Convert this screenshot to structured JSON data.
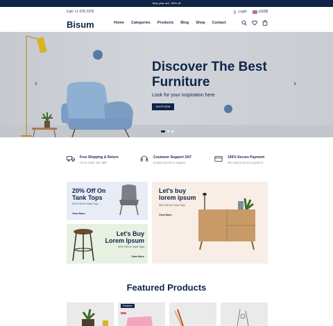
{
  "announcement": "New year sell : 30% off",
  "contact": "Call: +1 078 2376",
  "account": {
    "login_label": "Login",
    "currency_label": "USD$"
  },
  "brand": {
    "name": "Bisum"
  },
  "nav": {
    "items": [
      "Home",
      "Categories",
      "Products",
      "Blog",
      "Shop",
      "Contact"
    ]
  },
  "hero": {
    "title": "Discover The Best Furniture",
    "subtitle": "Look for your inspiration here",
    "button": "SHOP NOW"
  },
  "features": [
    {
      "title": "Free Shipping & Return",
      "subtitle": "All on order over $99",
      "icon": "truck-icon"
    },
    {
      "title": "Customer Support 24/7",
      "subtitle": "Instant access to support",
      "icon": "headset-icon"
    },
    {
      "title": "100% Secure Payment",
      "subtitle": "We ensure secure payment",
      "icon": "credit-card-icon"
    }
  ],
  "banners": [
    {
      "title": "20% Off On Tank Tops",
      "subtitle": "20% Off On Tank Tops",
      "link": "View More"
    },
    {
      "title": "Let's Buy Lorem Ipsum",
      "subtitle": "30% Off On Tank Tops",
      "link": "View More"
    },
    {
      "title": "Let's buy lorem ipsum",
      "subtitle": "50% Off On Tank Tops",
      "link": "View More"
    }
  ],
  "featured": {
    "title": "Featured Products",
    "badge": "Featured"
  },
  "colors": {
    "primary": "#0f2447",
    "banner_blue": "#e7ecf7",
    "banner_green": "#e7f0e1",
    "banner_peach": "#f8eee5"
  }
}
